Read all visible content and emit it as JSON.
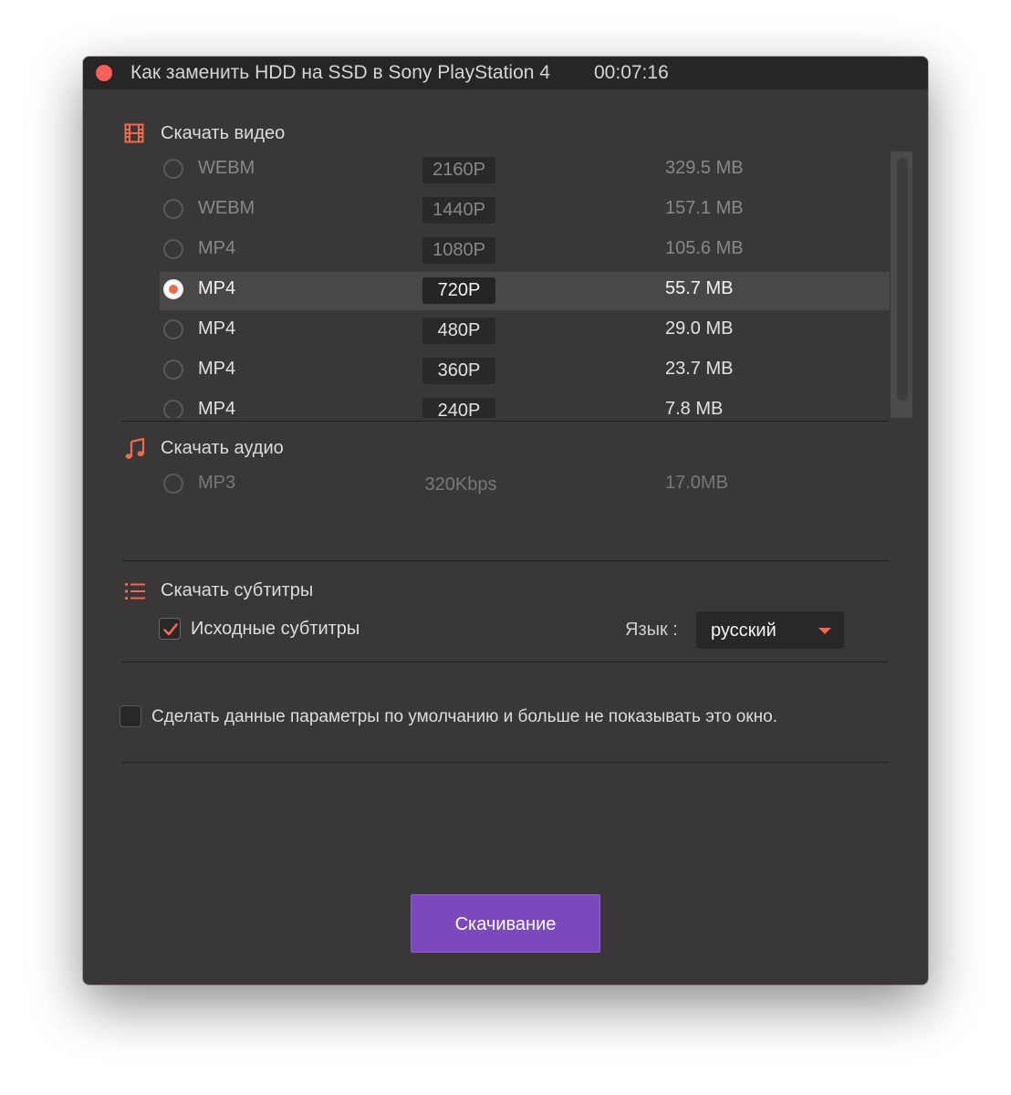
{
  "window": {
    "title": "Как заменить HDD на SSD в Sony PlayStation 4",
    "duration": "00:07:16"
  },
  "video_section": {
    "title": "Скачать видео",
    "icon": "film-icon",
    "rows": [
      {
        "format": "WEBM",
        "resolution": "2160P",
        "size": "329.5 MB",
        "selected": false
      },
      {
        "format": "WEBM",
        "resolution": "1440P",
        "size": "157.1 MB",
        "selected": false
      },
      {
        "format": "MP4",
        "resolution": "1080P",
        "size": "105.6 MB",
        "selected": false
      },
      {
        "format": "MP4",
        "resolution": "720P",
        "size": "55.7 MB",
        "selected": true
      },
      {
        "format": "MP4",
        "resolution": "480P",
        "size": "29.0 MB",
        "selected": false
      },
      {
        "format": "MP4",
        "resolution": "360P",
        "size": "23.7 MB",
        "selected": false
      },
      {
        "format": "MP4",
        "resolution": "240P",
        "size": "7.8 MB",
        "selected": false
      }
    ]
  },
  "audio_section": {
    "title": "Скачать аудио",
    "icon": "music-note-icon",
    "row": {
      "format": "MP3",
      "bitrate": "320Kbps",
      "size": "17.0MB",
      "selected": false
    }
  },
  "subtitles_section": {
    "title": "Скачать субтитры",
    "icon": "list-icon",
    "original_label": "Исходные субтитры",
    "original_checked": true,
    "language_label": "Язык :",
    "language_value": "русский"
  },
  "default_option": {
    "label": "Сделать данные параметры по умолчанию и больше не показывать это окно.",
    "checked": false
  },
  "download_button": {
    "label": "Скачивание"
  },
  "colors": {
    "accent": "#f2694a",
    "button": "#7b48bd",
    "background": "#3a3738",
    "titlebar": "#272526"
  }
}
